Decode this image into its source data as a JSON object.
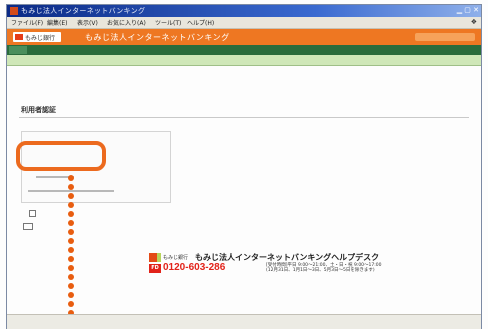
{
  "window": {
    "title": "もみじ法人インターネットバンキング"
  },
  "menu": {
    "items": [
      "ファイル(F)",
      "編集(E)",
      "表示(V)",
      "お気に入り(A)",
      "ツール(T)",
      "ヘルプ(H)"
    ]
  },
  "header": {
    "logo": "もみじ銀行",
    "title": "もみじ法人インターネットバンキング"
  },
  "page": {
    "title": "利用者認証"
  },
  "help": {
    "bank": "もみじ銀行",
    "title": "もみじ法人インターネットバンキングヘルプデスク",
    "free_dial": "フリーダイヤル",
    "phone": "0120-603-286",
    "hours_1": "[受付時間]平日 9:00～21:00、土・日・祝 9:00～17:00",
    "hours_2": "(12月31日、1月1日～3日、5月3日～5日を除きます)"
  },
  "accent": {
    "callout": "#ec6a1e",
    "brand": "#ee7722",
    "nav": "#2a6c3c",
    "phone": "#e2231a"
  }
}
